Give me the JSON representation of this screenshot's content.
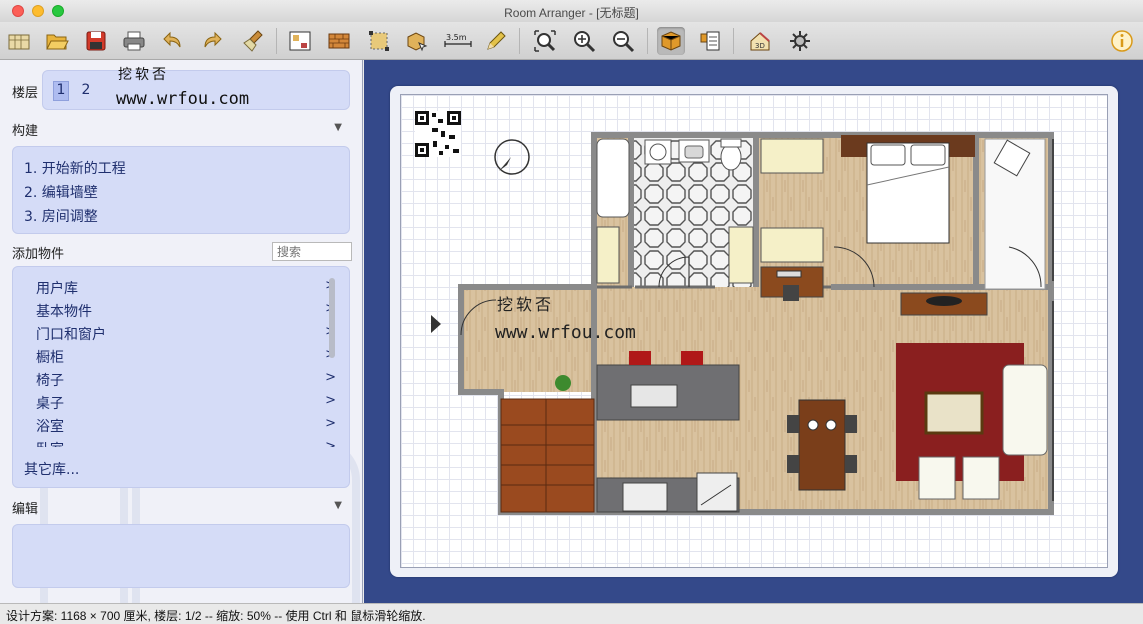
{
  "window": {
    "title": "Room Arranger - [无标题]"
  },
  "toolbar": {
    "scale_label": "3.5m",
    "icons": [
      "new-project-icon",
      "open-folder-icon",
      "save-icon",
      "print-icon",
      "undo-icon",
      "redo-icon",
      "clean-brush-icon",
      "room-properties-icon",
      "wall-brick-icon",
      "select-area-icon",
      "move-objects-icon",
      "dimension-icon",
      "pencil-icon",
      "zoom-fit-icon",
      "zoom-in-icon",
      "zoom-out-icon",
      "3d-box-icon",
      "object-list-icon",
      "house-3d-icon",
      "settings-gear-icon",
      "info-icon"
    ]
  },
  "left_panel": {
    "floor": {
      "label": "楼层",
      "floors": [
        "1",
        "2"
      ],
      "selected": "1"
    },
    "watermark_top": {
      "line1": "挖软否",
      "line2": "www.wrfou.com"
    },
    "build": {
      "label": "构建",
      "steps": [
        "1. 开始新的工程",
        "2. 编辑墙壁",
        "3. 房间调整"
      ]
    },
    "add_objects": {
      "label": "添加物件",
      "search_placeholder": "搜索",
      "items": [
        "用户库",
        "基本物件",
        "门口和窗户",
        "橱柜",
        "椅子",
        "桌子",
        "浴室",
        "卧室"
      ],
      "chevron": ">",
      "other_label": "其它库..."
    },
    "edit": {
      "label": "编辑"
    }
  },
  "plan": {
    "watermark": {
      "line1": "挖软否",
      "line2": "www.wrfou.com"
    }
  },
  "statusbar": {
    "text": "设计方案: 1168 × 700 厘米, 楼层: 1/2 -- 缩放: 50% -- 使用 Ctrl 和 鼠标滑轮缩放."
  },
  "colors": {
    "canvas_bg": "#34498a",
    "panel_box": "#d5dcf7",
    "link_text": "#1f2f6e",
    "wall": "#8a8a8a",
    "floor_wood": "#d8c2a0",
    "rug": "#8a1f1f"
  }
}
